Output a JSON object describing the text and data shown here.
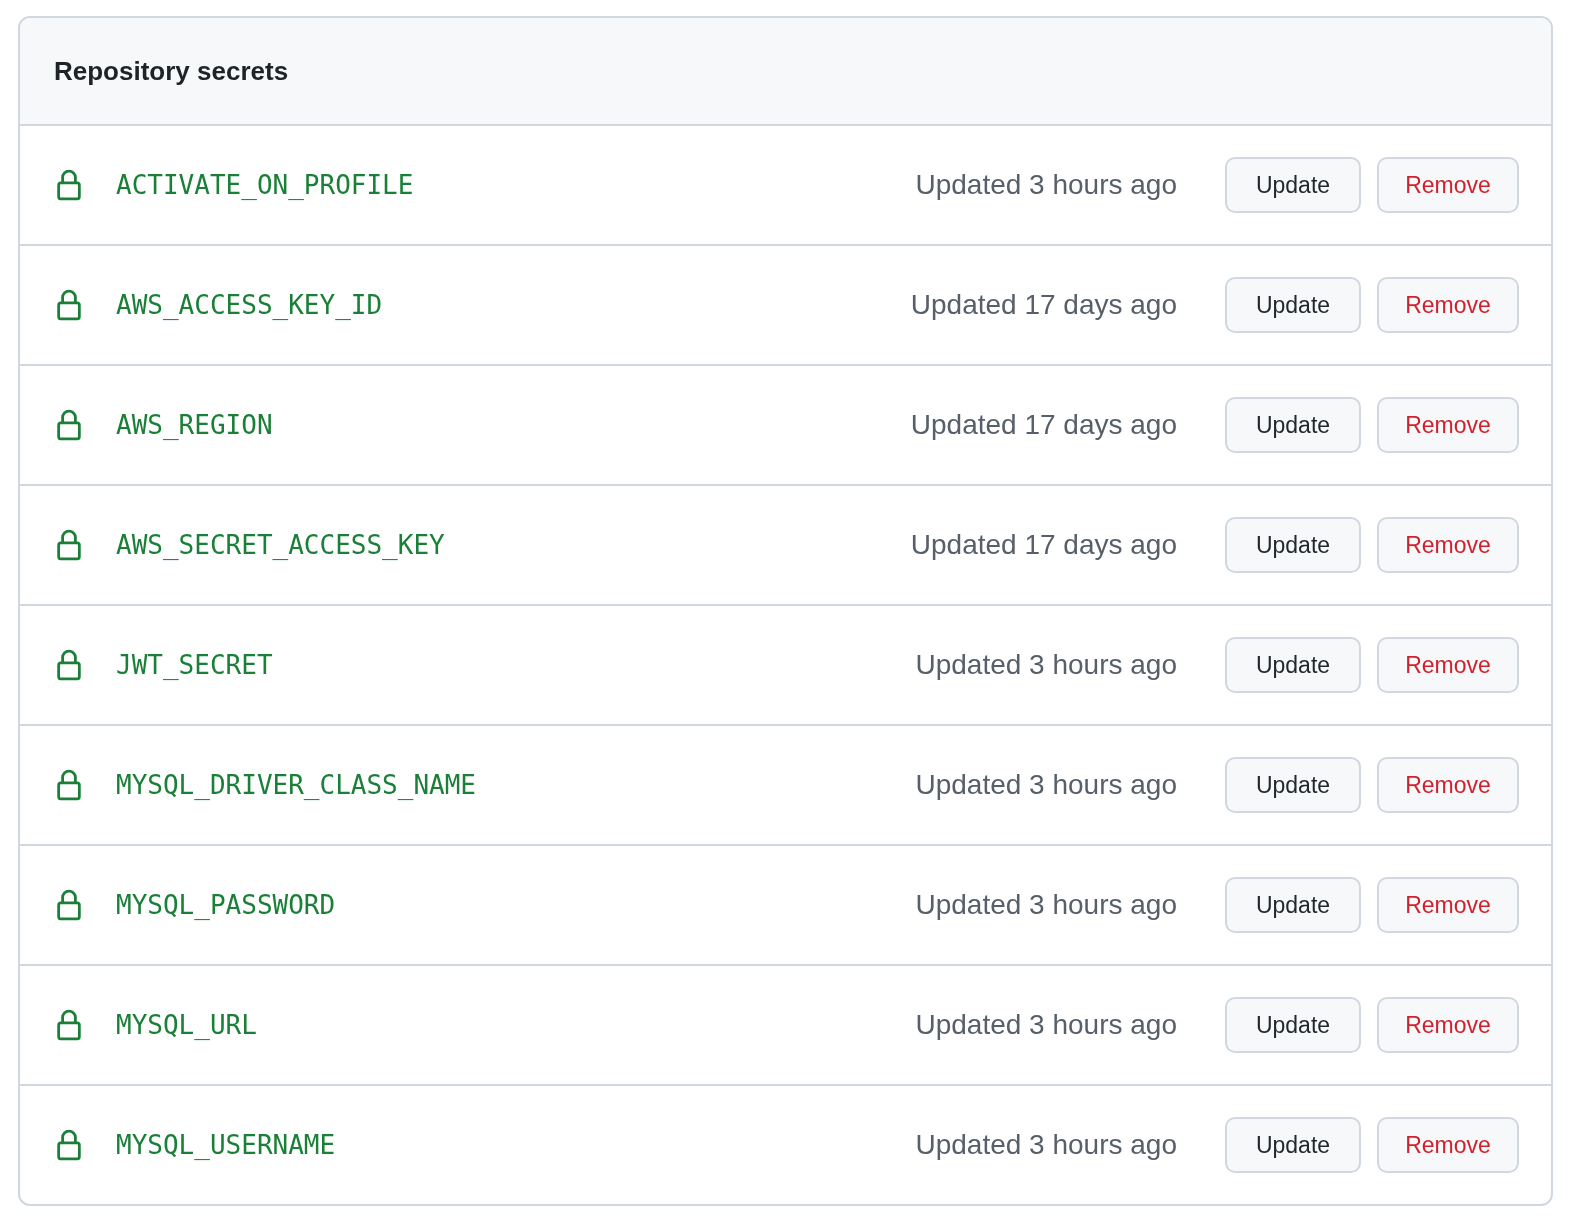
{
  "header": {
    "title": "Repository secrets"
  },
  "secrets": [
    {
      "name": "ACTIVATE_ON_PROFILE",
      "updated": "Updated 3 hours ago",
      "update_button": "Update",
      "remove_button": "Remove"
    },
    {
      "name": "AWS_ACCESS_KEY_ID",
      "updated": "Updated 17 days ago",
      "update_button": "Update",
      "remove_button": "Remove"
    },
    {
      "name": "AWS_REGION",
      "updated": "Updated 17 days ago",
      "update_button": "Update",
      "remove_button": "Remove"
    },
    {
      "name": "AWS_SECRET_ACCESS_KEY",
      "updated": "Updated 17 days ago",
      "update_button": "Update",
      "remove_button": "Remove"
    },
    {
      "name": "JWT_SECRET",
      "updated": "Updated 3 hours ago",
      "update_button": "Update",
      "remove_button": "Remove"
    },
    {
      "name": "MYSQL_DRIVER_CLASS_NAME",
      "updated": "Updated 3 hours ago",
      "update_button": "Update",
      "remove_button": "Remove"
    },
    {
      "name": "MYSQL_PASSWORD",
      "updated": "Updated 3 hours ago",
      "update_button": "Update",
      "remove_button": "Remove"
    },
    {
      "name": "MYSQL_URL",
      "updated": "Updated 3 hours ago",
      "update_button": "Update",
      "remove_button": "Remove"
    },
    {
      "name": "MYSQL_USERNAME",
      "updated": "Updated 3 hours ago",
      "update_button": "Update",
      "remove_button": "Remove"
    }
  ]
}
